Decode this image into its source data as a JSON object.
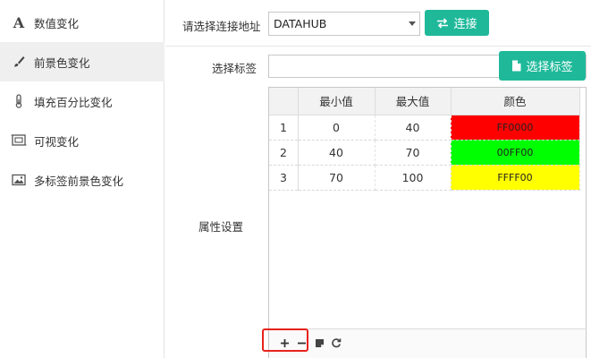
{
  "sidebar": {
    "items": [
      {
        "label": "数值变化",
        "icon": "font-a-icon"
      },
      {
        "label": "前景色变化",
        "icon": "paint-brush-icon"
      },
      {
        "label": "填充百分比变化",
        "icon": "thermometer-icon"
      },
      {
        "label": "可视变化",
        "icon": "screen-frame-icon"
      },
      {
        "label": "多标签前景色变化",
        "icon": "image-icon"
      }
    ],
    "active_index": 1
  },
  "connection": {
    "label": "请选择连接地址",
    "selected": "DATAHUB",
    "connect_button": "连接"
  },
  "tag": {
    "label": "选择标签",
    "value": "",
    "select_button": "选择标签"
  },
  "properties": {
    "label": "属性设置",
    "columns": [
      "",
      "最小值",
      "最大值",
      "颜色"
    ],
    "rows": [
      {
        "n": "1",
        "min": "0",
        "max": "40",
        "color": "FF0000",
        "bg": "#ff0000"
      },
      {
        "n": "2",
        "min": "40",
        "max": "70",
        "color": "00FF00",
        "bg": "#00ff00"
      },
      {
        "n": "3",
        "min": "70",
        "max": "100",
        "color": "FFFF00",
        "bg": "#ffff00"
      }
    ]
  },
  "colors": {
    "accent": "#1fb99a",
    "highlight": "#e8221c"
  }
}
